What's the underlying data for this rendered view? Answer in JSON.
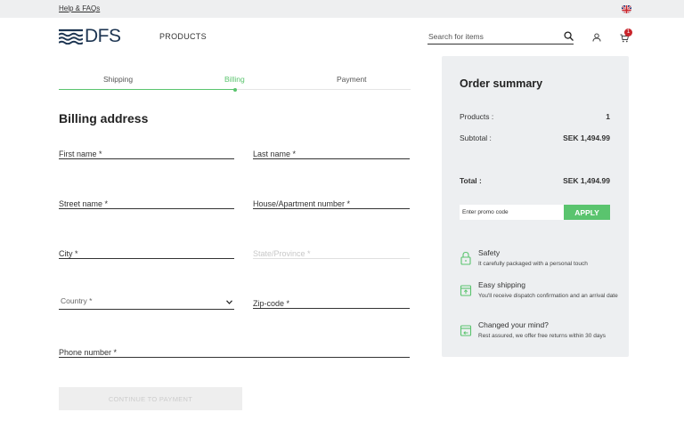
{
  "topbar": {
    "help_link": "Help & FAQs"
  },
  "header": {
    "brand": "DFS",
    "nav_products": "PRODUCTS",
    "search_placeholder": "Search for items",
    "cart_count": "1"
  },
  "steps": [
    {
      "label": "Shipping",
      "active": false
    },
    {
      "label": "Billing",
      "active": true
    },
    {
      "label": "Payment",
      "active": false
    }
  ],
  "billing": {
    "title": "Billing address",
    "first_name": "First name *",
    "last_name": "Last name *",
    "street_name": "Street name *",
    "house_number": "House/Apartment number *",
    "city": "City *",
    "state": "State/Province *",
    "country": "Country *",
    "zip": "Zip-code *",
    "phone": "Phone number *",
    "continue_label": "CONTINUE TO PAYMENT"
  },
  "summary": {
    "title": "Order summary",
    "products_label": "Products :",
    "products_value": "1",
    "subtotal_label": "Subtotal :",
    "subtotal_value": "SEK 1,494.99",
    "total_label": "Total :",
    "total_value": "SEK 1,494.99",
    "promo_placeholder": "Enter promo code",
    "apply_label": "APPLY"
  },
  "features": [
    {
      "icon": "lock-icon",
      "title": "Safety",
      "desc": "It carefully packaged with a personal touch"
    },
    {
      "icon": "package-icon",
      "title": "Easy shipping",
      "desc": "You'll receive dispatch confirmation and an arrival date"
    },
    {
      "icon": "return-box-icon",
      "title": "Changed your mind?",
      "desc": "Rest assured, we offer free returns within 30 days"
    }
  ],
  "colors": {
    "accent": "#5ac46e",
    "brand": "#1d3552",
    "badge": "#c9252c",
    "summary_bg": "#edeff1"
  }
}
